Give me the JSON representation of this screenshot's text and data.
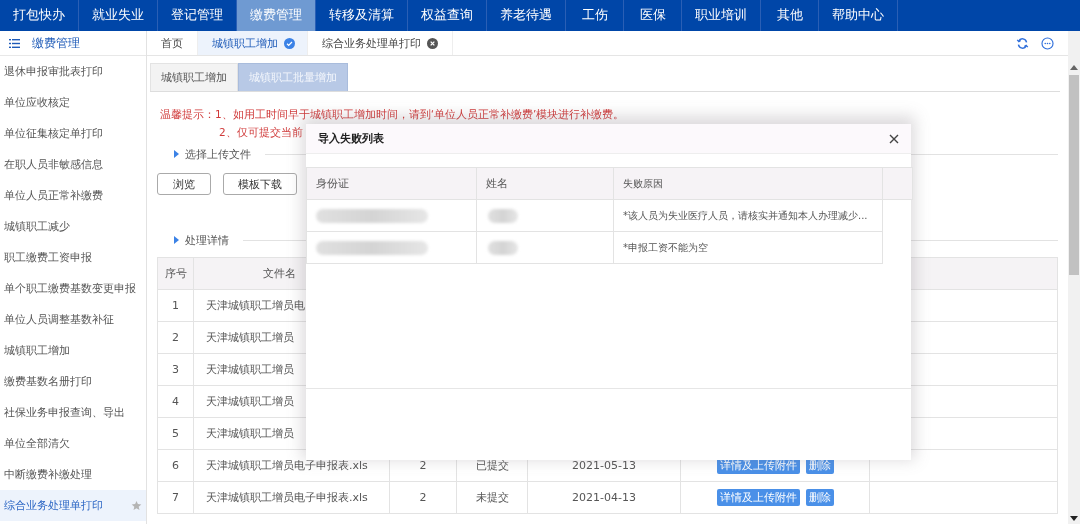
{
  "top_nav": [
    {
      "label": "打包快办",
      "selected": false
    },
    {
      "label": "就业失业",
      "selected": false
    },
    {
      "label": "登记管理",
      "selected": false
    },
    {
      "label": "缴费管理",
      "selected": true
    },
    {
      "label": "转移及清算",
      "selected": false
    },
    {
      "label": "权益查询",
      "selected": false
    },
    {
      "label": "养老待遇",
      "selected": false
    },
    {
      "label": "工伤",
      "selected": false
    },
    {
      "label": "医保",
      "selected": false
    },
    {
      "label": "职业培训",
      "selected": false
    },
    {
      "label": "其他",
      "selected": false
    },
    {
      "label": "帮助中心",
      "selected": false
    }
  ],
  "sidebar": {
    "title": "缴费管理",
    "items": [
      {
        "label": "退休申报审批表打印",
        "selected": false
      },
      {
        "label": "单位应收核定",
        "selected": false
      },
      {
        "label": "单位征集核定单打印",
        "selected": false
      },
      {
        "label": "在职人员非敏感信息",
        "selected": false
      },
      {
        "label": "单位人员正常补缴费",
        "selected": false
      },
      {
        "label": "城镇职工减少",
        "selected": false
      },
      {
        "label": "职工缴费工资申报",
        "selected": false
      },
      {
        "label": "单个职工缴费基数变更申报",
        "selected": false
      },
      {
        "label": "单位人员调整基数补征",
        "selected": false
      },
      {
        "label": "城镇职工增加",
        "selected": false
      },
      {
        "label": "缴费基数名册打印",
        "selected": false
      },
      {
        "label": "社保业务申报查询、导出",
        "selected": false
      },
      {
        "label": "单位全部清欠",
        "selected": false
      },
      {
        "label": "中断缴费补缴处理",
        "selected": false
      },
      {
        "label": "综合业务处理单打印",
        "selected": true
      }
    ]
  },
  "page_tabs": [
    {
      "label": "首页",
      "selected": false,
      "closable": false
    },
    {
      "label": "城镇职工增加",
      "selected": true,
      "closable": true
    },
    {
      "label": "综合业务处理单打印",
      "selected": false,
      "closable": true
    }
  ],
  "sub_tabs": [
    {
      "label": "城镇职工增加",
      "selected": false
    },
    {
      "label": "城镇职工批量增加",
      "selected": true
    }
  ],
  "notice": {
    "line_1": "温馨提示：1、如用工时间早于城镇职工增加时间，请到‘单位人员正常补缴费’模块进行补缴费。",
    "line_2": "2、仅可提交当前"
  },
  "upload_section": {
    "title": "选择上传文件",
    "buttons": [
      "浏览",
      "模板下载"
    ]
  },
  "details_section": {
    "title": "处理详情"
  },
  "table": {
    "columns": [
      "序号",
      "文件名"
    ],
    "rows": [
      {
        "index": "1",
        "file": "天津城镇职工增员电"
      },
      {
        "index": "2",
        "file": "天津城镇职工增员"
      },
      {
        "index": "3",
        "file": "天津城镇职工增员"
      },
      {
        "index": "4",
        "file": "天津城镇职工增员"
      },
      {
        "index": "5",
        "file": "天津城镇职工增员"
      },
      {
        "index": "6",
        "file": "天津城镇职工增员电子申报表.xls",
        "count": "2",
        "status": "已提交",
        "date": "2021-05-13",
        "actions": [
          "详情及上传附件",
          "删除"
        ]
      },
      {
        "index": "7",
        "file": "天津城镇职工增员电子申报表.xls",
        "count": "2",
        "status": "未提交",
        "date": "2021-04-13",
        "actions": [
          "详情及上传附件",
          "删除"
        ]
      }
    ]
  },
  "dialog": {
    "title": "导入失败列表",
    "columns": [
      "身份证",
      "姓名",
      "失败原因"
    ],
    "rows": [
      {
        "reason": "*该人员为失业医疗人员，请核实并通知本人办理减少..."
      },
      {
        "reason": "*申报工资不能为空"
      }
    ]
  }
}
